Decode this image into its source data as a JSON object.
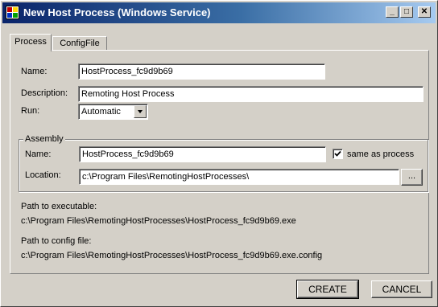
{
  "window": {
    "title": "New Host Process (Windows Service)",
    "minimize_glyph": "_",
    "maximize_glyph": "□",
    "close_glyph": "✕"
  },
  "tabs": [
    {
      "label": "Process",
      "active": true
    },
    {
      "label": "ConfigFile",
      "active": false
    }
  ],
  "process": {
    "name_label": "Name:",
    "name_value": "HostProcess_fc9d9b69",
    "description_label": "Description:",
    "description_value": "Remoting Host Process",
    "run_label": "Run:",
    "run_value": "Automatic"
  },
  "assembly": {
    "group_title": "Assembly",
    "name_label": "Name:",
    "name_value": "HostProcess_fc9d9b69",
    "same_as_process_label": "same as process",
    "same_as_process_checked": true,
    "location_label": "Location:",
    "location_value": "c:\\Program Files\\RemotingHostProcesses\\",
    "browse_label": "..."
  },
  "paths": {
    "executable_label": "Path to executable:",
    "executable_value": "c:\\Program Files\\RemotingHostProcesses\\HostProcess_fc9d9b69.exe",
    "config_label": "Path to config file:",
    "config_value": "c:\\Program Files\\RemotingHostProcesses\\HostProcess_fc9d9b69.exe.config"
  },
  "buttons": {
    "create_label": "CREATE",
    "cancel_label": "CANCEL"
  },
  "colors": {
    "titlebar_start": "#0a246a",
    "titlebar_end": "#a6caf0",
    "face": "#d4d0c8"
  }
}
